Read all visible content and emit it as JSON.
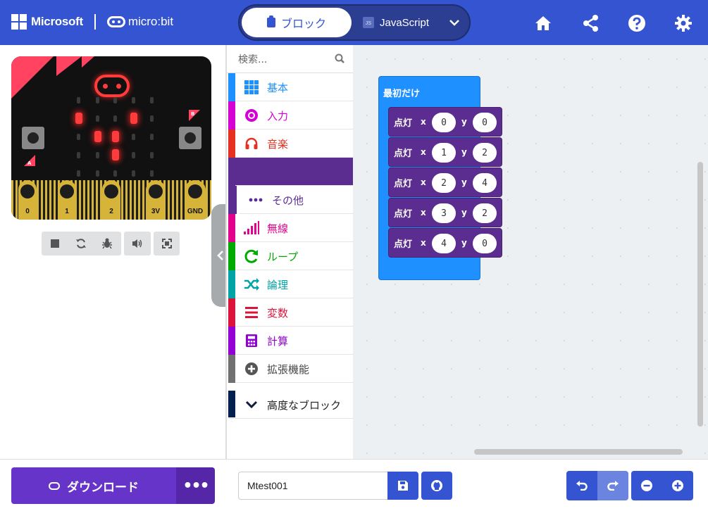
{
  "header": {
    "ms_label": "Microsoft",
    "mb_label": "micro:bit",
    "tab_blocks": "ブロック",
    "tab_js": "JavaScript",
    "js_badge": "JS"
  },
  "colors": {
    "brand": "#3454d1",
    "led_on": "#ff3b3b",
    "pins": "#d6b43a"
  },
  "simulator": {
    "pins": [
      "0",
      "1",
      "2",
      "3V",
      "GND"
    ],
    "button_a": "A",
    "button_b": "B",
    "leds_on": [
      [
        0,
        1
      ],
      [
        3,
        1
      ],
      [
        1,
        2
      ],
      [
        2,
        2
      ],
      [
        2,
        3
      ]
    ],
    "controls": [
      "stop-icon",
      "restart-icon",
      "debug-icon",
      "sound-icon",
      "fullscreen-icon"
    ]
  },
  "toolbox": {
    "search_placeholder": "検索...",
    "categories": [
      {
        "label": "基本",
        "color": "#1e90ff",
        "icon": "grid-icon"
      },
      {
        "label": "入力",
        "color": "#d400d4",
        "icon": "target-icon"
      },
      {
        "label": "音楽",
        "color": "#e63022",
        "icon": "headphones-icon"
      },
      {
        "label": "",
        "color": "#5c2d91",
        "icon": "led-icon"
      },
      {
        "label": "その他",
        "color": "#5c2d91",
        "icon": "more-icon"
      },
      {
        "label": "無線",
        "color": "#e3008c",
        "icon": "signal-icon"
      },
      {
        "label": "ループ",
        "color": "#00aa00",
        "icon": "loop-icon"
      },
      {
        "label": "論理",
        "color": "#00a4a6",
        "icon": "shuffle-icon"
      },
      {
        "label": "変数",
        "color": "#dc143c",
        "icon": "lines-icon"
      },
      {
        "label": "計算",
        "color": "#9400d3",
        "icon": "calculator-icon"
      },
      {
        "label": "拡張機能",
        "color": "#717171",
        "icon": "plus-circle-icon"
      },
      {
        "label": "高度なブロック",
        "color": "#002050",
        "icon": "chevron-down-icon"
      }
    ]
  },
  "workspace": {
    "onstart_label": "最初だけ",
    "plot_blocks": [
      {
        "label": "点灯",
        "x_label": "x",
        "y_label": "y",
        "x": "0",
        "y": "0"
      },
      {
        "label": "点灯",
        "x_label": "x",
        "y_label": "y",
        "x": "1",
        "y": "2"
      },
      {
        "label": "点灯",
        "x_label": "x",
        "y_label": "y",
        "x": "2",
        "y": "4"
      },
      {
        "label": "点灯",
        "x_label": "x",
        "y_label": "y",
        "x": "3",
        "y": "2"
      },
      {
        "label": "点灯",
        "x_label": "x",
        "y_label": "y",
        "x": "4",
        "y": "0"
      }
    ]
  },
  "footer": {
    "download_label": "ダウンロード",
    "more_label": "•••",
    "project_name": "Mtest001"
  }
}
